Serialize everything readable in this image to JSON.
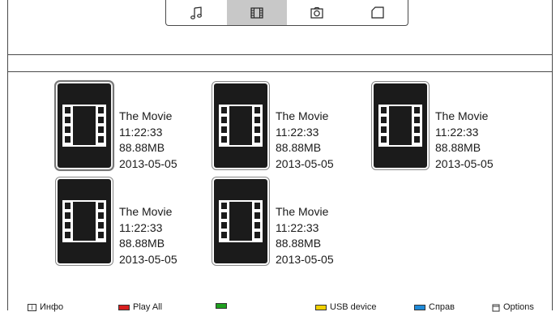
{
  "tabs": [
    {
      "name": "music",
      "icon": "music-note-icon",
      "active": false
    },
    {
      "name": "video",
      "icon": "film-icon",
      "active": true
    },
    {
      "name": "photo",
      "icon": "camera-icon",
      "active": false
    },
    {
      "name": "folder",
      "icon": "folder-icon",
      "active": false
    }
  ],
  "items": [
    {
      "title": "The Movie",
      "duration": "11:22:33",
      "size": "88.88MB",
      "date": "2013-05-05",
      "focused": true
    },
    {
      "title": "The Movie",
      "duration": "11:22:33",
      "size": "88.88MB",
      "date": "2013-05-05",
      "focused": false
    },
    {
      "title": "The Movie",
      "duration": "11:22:33",
      "size": "88.88MB",
      "date": "2013-05-05",
      "focused": false
    },
    {
      "title": "The Movie",
      "duration": "11:22:33",
      "size": "88.88MB",
      "date": "2013-05-05",
      "focused": false
    },
    {
      "title": "The Movie",
      "duration": "11:22:33",
      "size": "88.88MB",
      "date": "2013-05-05",
      "focused": false
    }
  ],
  "footer": {
    "info": "Инфо",
    "info_icon": "i",
    "red_label": "Play All",
    "green_label": "",
    "yellow_label": "USB device",
    "blue_label": "Справ",
    "options_label": "Options"
  },
  "colors": {
    "red": "#d81e1e",
    "green": "#1ea01e",
    "yellow": "#f0d000",
    "blue": "#1e8ad8",
    "active_tab": "#c8c8c8",
    "thumb_bg": "#1b1b1b"
  }
}
